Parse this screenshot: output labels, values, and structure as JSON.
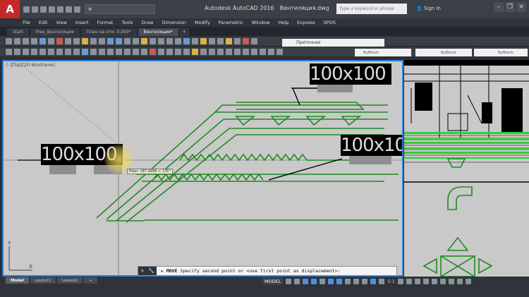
{
  "app": {
    "title": "Autodesk AutoCAD 2016",
    "document": "Вентиляция.dwg",
    "logo_letter": "A",
    "workspace": "",
    "search_placeholder": "Type a keyword or phrase",
    "signin": "Sign In"
  },
  "menu": [
    "File",
    "Edit",
    "View",
    "Insert",
    "Format",
    "Tools",
    "Draw",
    "Dimension",
    "Modify",
    "Parametric",
    "Window",
    "Help",
    "Express",
    "SPDS"
  ],
  "tabs": [
    {
      "label": "Start",
      "active": false
    },
    {
      "label": "Free_Вентиляция",
      "active": false
    },
    {
      "label": "План на отм. 0,000*",
      "active": false
    },
    {
      "label": "Вентиляция*",
      "active": true
    }
  ],
  "properties": {
    "layer": "Приточная",
    "color": "ByBlock",
    "linetype": "ByBlock",
    "lineweight": "ByBlock"
  },
  "drawing": {
    "dimension_labels": [
      "100x100",
      "100x100",
      "100x10"
    ],
    "polar_tooltip": "Polar: 187.9999 < 135°",
    "ucs_x": "X",
    "ucs_y": "Y"
  },
  "command": {
    "name": "MOVE",
    "prompt": "Specify second point or <use first point as displacement>:"
  },
  "status": {
    "layout_tabs": [
      {
        "label": "Model",
        "active": true
      },
      {
        "label": "Layout1",
        "active": false
      },
      {
        "label": "Layout2",
        "active": false
      }
    ],
    "add_layout": "+",
    "model": "MODEL",
    "scale": "1:1"
  },
  "colors": {
    "duct_green": "#1f8a1f",
    "bright_green": "#2fd12f",
    "viewport_border": "#2f7fd8",
    "canvas_bg": "#c9c9c9"
  }
}
